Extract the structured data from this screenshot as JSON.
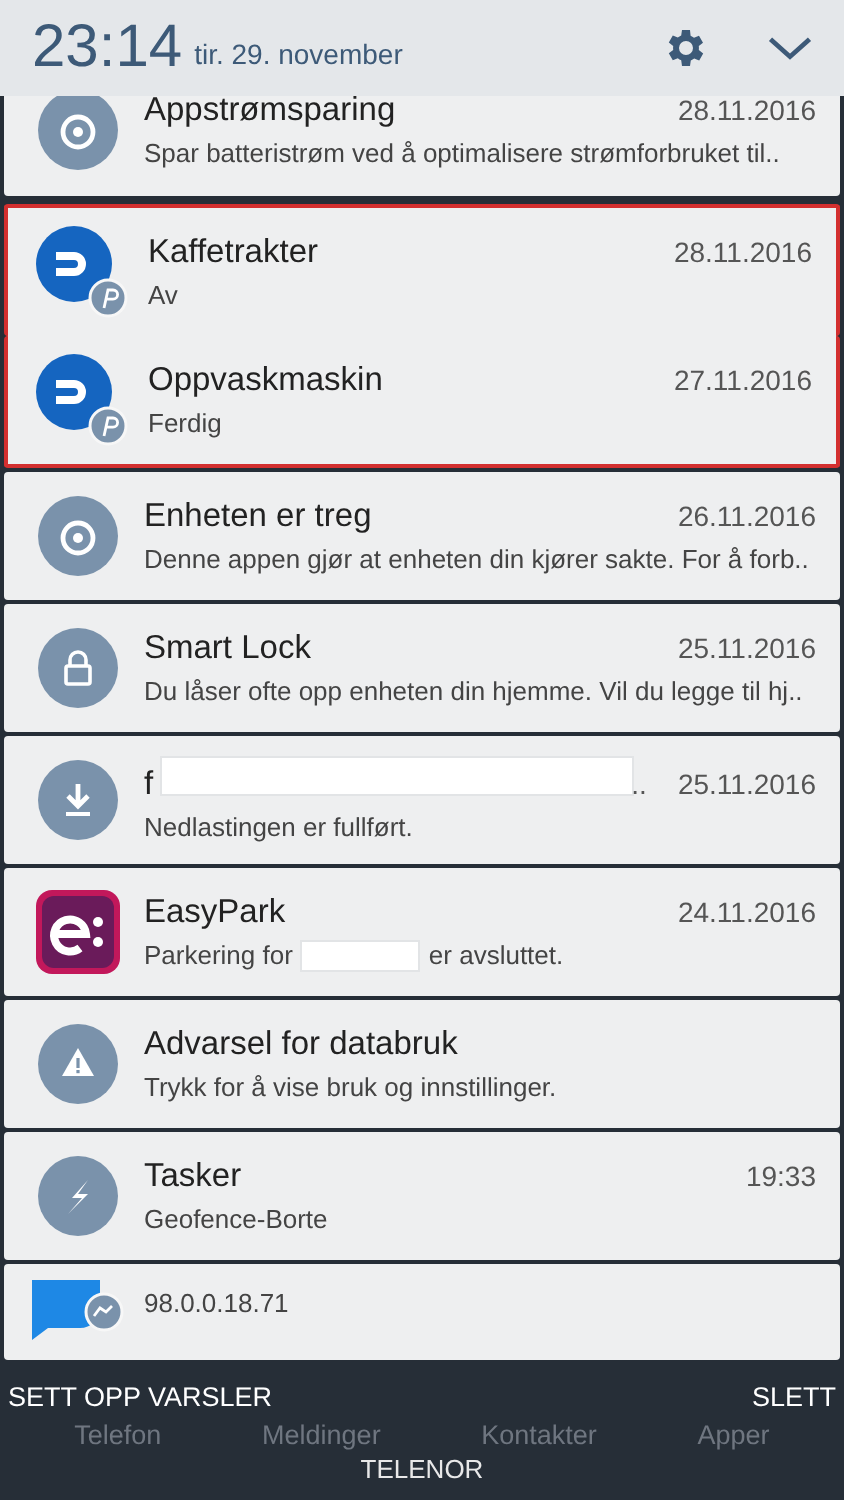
{
  "status": {
    "time": "23:14",
    "date": "tir. 29. november"
  },
  "notifications": [
    {
      "kind": "power",
      "title": "Appstrømsparing",
      "time": "28.11.2016",
      "body": "Spar batteristrøm ved å optimalisere strømforbruket til..",
      "highlighted": false,
      "partial": true
    },
    {
      "kind": "app-badge",
      "title": "Kaffetrakter",
      "time": "28.11.2016",
      "body": "Av",
      "highlighted": true
    },
    {
      "kind": "app-badge",
      "title": "Oppvaskmaskin",
      "time": "27.11.2016",
      "body": "Ferdig",
      "highlighted": true
    },
    {
      "kind": "power",
      "title": "Enheten er treg",
      "time": "26.11.2016",
      "body": "Denne appen gjør at enheten din kjører sakte. For å forb..",
      "highlighted": false
    },
    {
      "kind": "lock",
      "title": "Smart Lock",
      "time": "25.11.2016",
      "body": "Du låser ofte opp enheten din hjemme. Vil du legge til hj..",
      "highlighted": false
    },
    {
      "kind": "download",
      "title": "f",
      "title_redacted": true,
      "title_after": "..",
      "time": "25.11.2016",
      "body": "Nedlastingen er fullført.",
      "highlighted": false
    },
    {
      "kind": "easypark",
      "title": "EasyPark",
      "time": "24.11.2016",
      "body": "Parkering for",
      "body_redacted": true,
      "body_after": "er avsluttet.",
      "highlighted": false
    },
    {
      "kind": "warning",
      "title": "Advarsel for databruk",
      "body": "Trykk for å vise bruk og innstillinger.",
      "highlighted": false
    },
    {
      "kind": "bolt",
      "title": "Tasker",
      "time": "19:33",
      "body": "Geofence-Borte",
      "highlighted": false
    },
    {
      "kind": "messenger",
      "body": "98.0.0.18.71",
      "highlighted": false,
      "partial": true
    }
  ],
  "actions": [
    "SETT OPP VARSLER",
    "SLETT"
  ],
  "dock": [
    "Telefon",
    "Meldinger",
    "Kontakter",
    "Apper"
  ],
  "carrier": "TELENOR"
}
